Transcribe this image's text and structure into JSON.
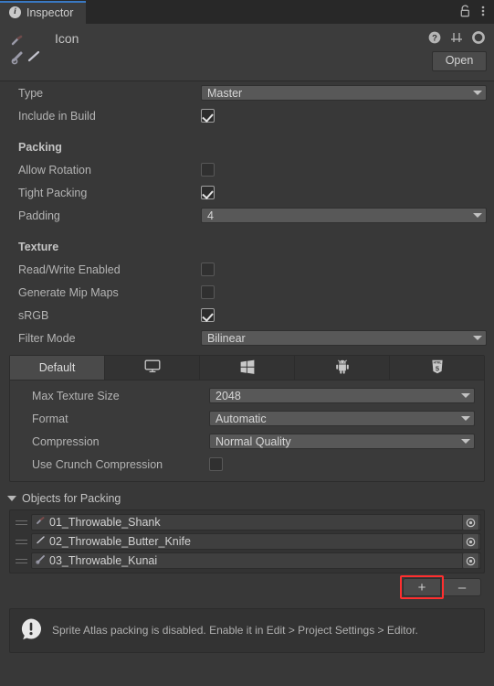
{
  "window": {
    "tab_label": "Inspector",
    "tab_icon": "info-icon",
    "lock_icon": "lock-icon",
    "menu_icon": "kebab-menu-icon",
    "accent_color": "#3a79c3",
    "background_color": "#383838"
  },
  "header": {
    "asset_name": "Icon",
    "help_icon": "help-icon",
    "preset_icon": "preset-sliders-icon",
    "settings_icon": "gear-icon",
    "open_label": "Open"
  },
  "properties": {
    "type": {
      "label": "Type",
      "value": "Master"
    },
    "include_in_build": {
      "label": "Include in Build",
      "checked": true
    }
  },
  "packing": {
    "section_label": "Packing",
    "allow_rotation": {
      "label": "Allow Rotation",
      "checked": false
    },
    "tight_packing": {
      "label": "Tight Packing",
      "checked": true
    },
    "padding": {
      "label": "Padding",
      "value": "4"
    }
  },
  "texture": {
    "section_label": "Texture",
    "read_write": {
      "label": "Read/Write Enabled",
      "checked": false
    },
    "mip_maps": {
      "label": "Generate Mip Maps",
      "checked": false
    },
    "srgb": {
      "label": "sRGB",
      "checked": true
    },
    "filter_mode": {
      "label": "Filter Mode",
      "value": "Bilinear"
    }
  },
  "platform_tabs": [
    {
      "label": "Default",
      "icon": "default-tab",
      "active": true
    },
    {
      "label": "",
      "icon": "standalone-monitor-icon",
      "active": false
    },
    {
      "label": "",
      "icon": "windows-icon",
      "active": false
    },
    {
      "label": "",
      "icon": "android-icon",
      "active": false
    },
    {
      "label": "",
      "icon": "html5-webgl-icon",
      "active": false
    }
  ],
  "platform_settings": {
    "max_texture_size": {
      "label": "Max Texture Size",
      "value": "2048"
    },
    "format": {
      "label": "Format",
      "value": "Automatic"
    },
    "compression": {
      "label": "Compression",
      "value": "Normal Quality"
    },
    "crunch_compression": {
      "label": "Use Crunch Compression",
      "checked": false
    }
  },
  "objects_for_packing": {
    "foldout_label": "Objects for Packing",
    "expanded": true,
    "items": [
      {
        "name": "01_Throwable_Shank"
      },
      {
        "name": "02_Throwable_Butter_Knife"
      },
      {
        "name": "03_Throwable_Kunai"
      }
    ],
    "add_label": "+",
    "remove_label": "–",
    "highlight_color": "#ff2f2f"
  },
  "help_box": {
    "icon": "warning-icon",
    "message": "Sprite Atlas packing is disabled. Enable it in Edit > Project Settings > Editor."
  }
}
